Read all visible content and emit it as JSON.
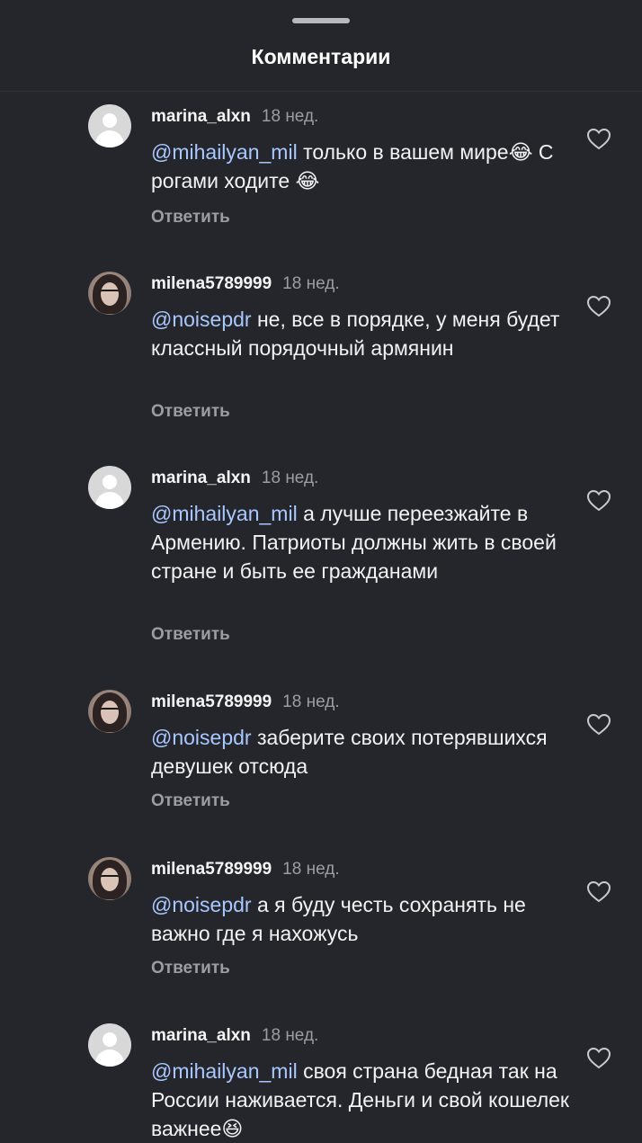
{
  "header": {
    "title": "Комментарии"
  },
  "comments": [
    {
      "username": "marina_alxn",
      "time": "18 нед.",
      "mention": "@mihailyan_mil",
      "text": " только в вашем мире😂 С рогами ходите 😂",
      "reply": "Ответить",
      "avatar": "default-avatar-icon"
    },
    {
      "username": "milena5789999",
      "time": "18 нед.",
      "mention": "@noisepdr",
      "text": " не, все в порядке, у меня будет классный порядочный армянин",
      "reply": "Ответить",
      "avatar": "profile-photo"
    },
    {
      "username": "marina_alxn",
      "time": "18 нед.",
      "mention": "@mihailyan_mil",
      "text": " а лучше переезжайте в Армению. Патриоты должны жить в своей стране и быть ее гражданами",
      "reply": "Ответить",
      "avatar": "default-avatar-icon"
    },
    {
      "username": "milena5789999",
      "time": "18 нед.",
      "mention": "@noisepdr",
      "text": " заберите своих потерявшихся девушек отсюда",
      "reply": "Ответить",
      "avatar": "profile-photo"
    },
    {
      "username": "milena5789999",
      "time": "18 нед.",
      "mention": "@noisepdr",
      "text": " а я буду честь сохранять не важно где я нахожусь",
      "reply": "Ответить",
      "avatar": "profile-photo"
    },
    {
      "username": "marina_alxn",
      "time": "18 нед.",
      "mention": "@mihailyan_mil",
      "text": " своя страна бедная так на России наживается. Деньги и свой кошелек важнее😆",
      "reply": "Ответить",
      "avatar": "default-avatar-icon"
    }
  ],
  "colors": {
    "background": "#24262b",
    "mention": "#a9c8ff",
    "secondary_text": "#9b9da3"
  }
}
